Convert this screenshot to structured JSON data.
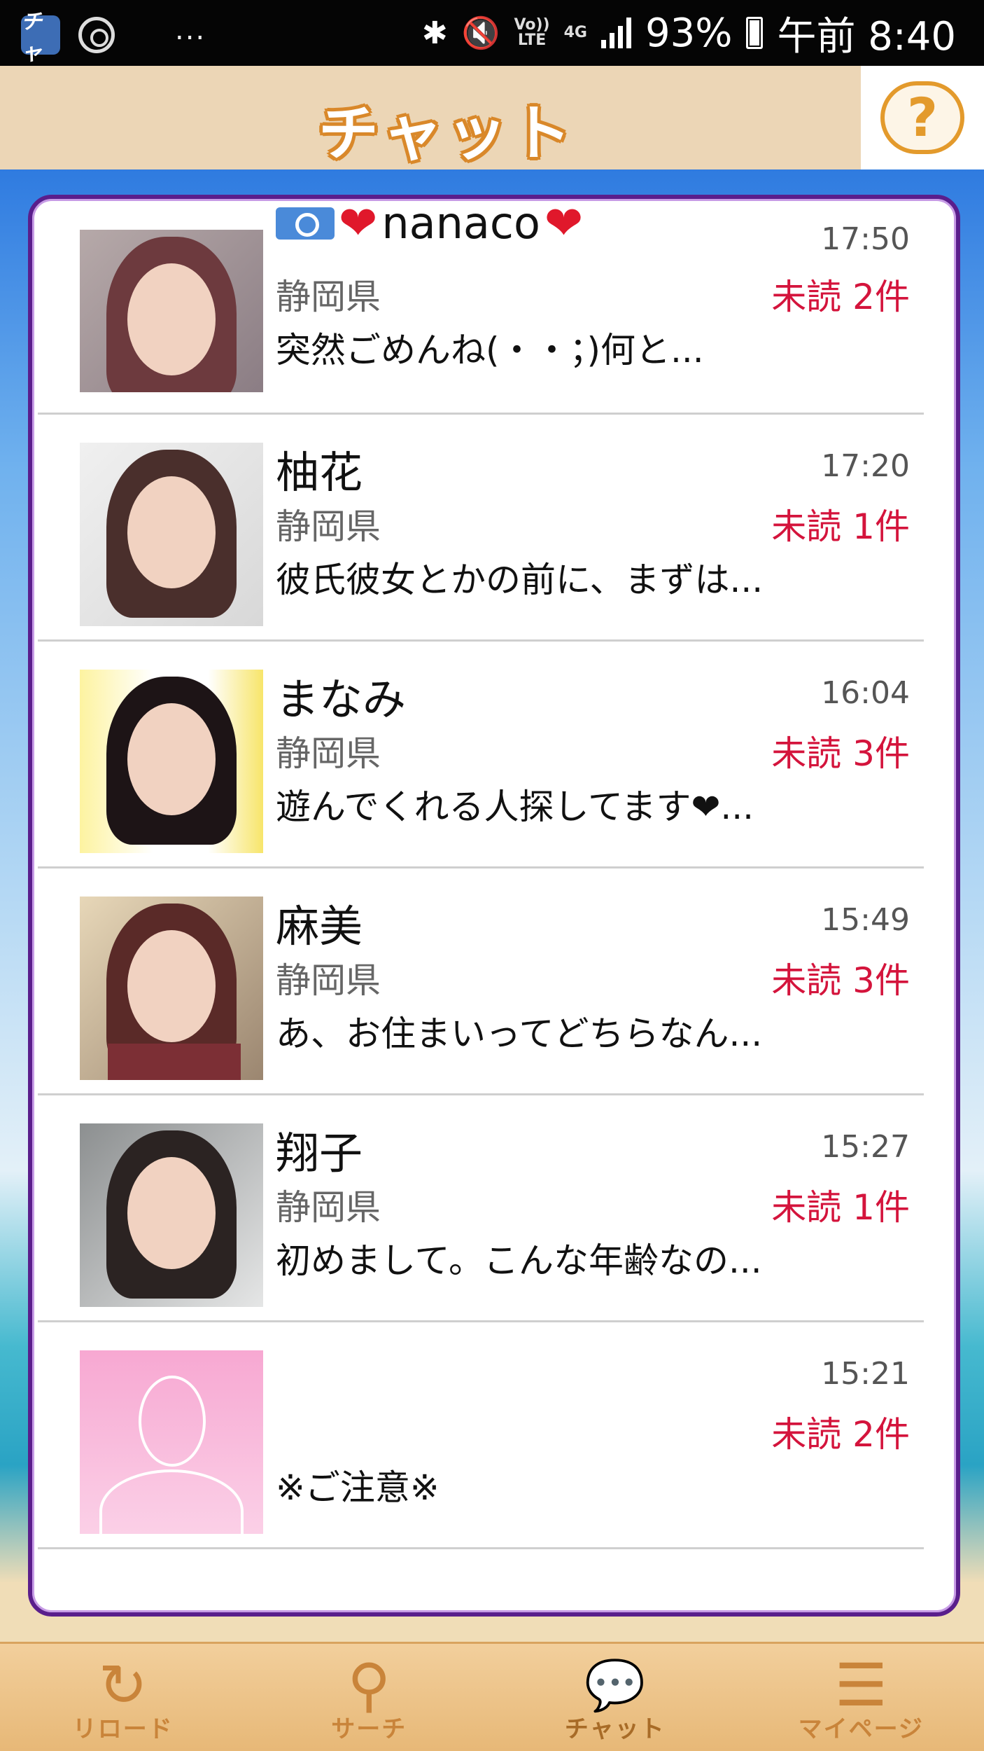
{
  "status_bar": {
    "app_badge": "チャ",
    "dots": "...",
    "volte": "Vo))\nLTE",
    "network": "4G",
    "battery": "93%",
    "time": "午前 8:40"
  },
  "header": {
    "title": "チャット",
    "help_label": "?"
  },
  "chats": [
    {
      "name": "nanaco",
      "has_camera": true,
      "hearts": true,
      "time": "17:50",
      "prefecture": "静岡県",
      "unread": "未読 2件",
      "message": "突然ごめんね(・・；)何と..."
    },
    {
      "name": "柚花",
      "time": "17:20",
      "prefecture": "静岡県",
      "unread": "未読 1件",
      "message": "彼氏彼女とかの前に、まずは..."
    },
    {
      "name": "まなみ",
      "time": "16:04",
      "prefecture": "静岡県",
      "unread": "未読 3件",
      "message": "遊んでくれる人探してます❤..."
    },
    {
      "name": "麻美",
      "time": "15:49",
      "prefecture": "静岡県",
      "unread": "未読 3件",
      "message": "あ、お住まいってどちらなん..."
    },
    {
      "name": "翔子",
      "time": "15:27",
      "prefecture": "静岡県",
      "unread": "未読 1件",
      "message": "初めまして。こんな年齢なの..."
    },
    {
      "name": "",
      "time": "15:21",
      "prefecture": "",
      "unread": "未読 2件",
      "message": "※ご注意※"
    }
  ],
  "bottom_nav": [
    {
      "label": "リロード",
      "icon": "reload-icon"
    },
    {
      "label": "サーチ",
      "icon": "search-icon"
    },
    {
      "label": "チャット",
      "icon": "chat-icon"
    },
    {
      "label": "マイページ",
      "icon": "menu-icon"
    }
  ]
}
